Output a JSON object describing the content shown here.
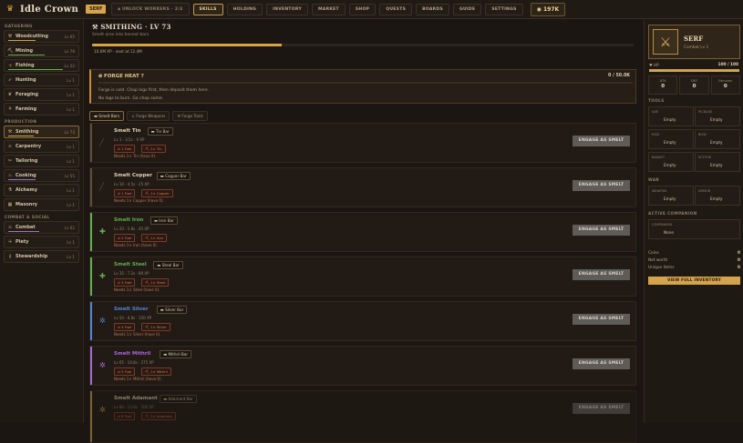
{
  "header": {
    "title": "Idle Crown",
    "rank_badge": "SERF",
    "unlock": "UNLOCK WORKERS · 2/4",
    "nav": [
      "SKILLS",
      "HOLDING",
      "INVENTORY",
      "MARKET",
      "SHOP",
      "QUESTS",
      "BOARDS",
      "GUIDE",
      "SETTINGS"
    ],
    "coins": "197K"
  },
  "sidebar": {
    "gathering_title": "GATHERING",
    "gathering": [
      {
        "name": "Woodcutting",
        "level": "Lv 65"
      },
      {
        "name": "Mining",
        "level": "Lv 78"
      },
      {
        "name": "Fishing",
        "level": "Lv 22"
      },
      {
        "name": "Hunting",
        "level": "Lv 1"
      },
      {
        "name": "Foraging",
        "level": "Lv 1"
      },
      {
        "name": "Farming",
        "level": "Lv 1"
      }
    ],
    "production_title": "PRODUCTION",
    "production": [
      {
        "name": "Smithing",
        "level": "Lv 73"
      },
      {
        "name": "Carpentry",
        "level": "Lv 1"
      },
      {
        "name": "Tailoring",
        "level": "Lv 1"
      },
      {
        "name": "Cooking",
        "level": "Lv 55"
      },
      {
        "name": "Alchemy",
        "level": "Lv 1"
      },
      {
        "name": "Masonry",
        "level": "Lv 1"
      }
    ],
    "combat_title": "COMBAT & SOCIAL",
    "combat": [
      {
        "name": "Combat",
        "level": "Lv 62"
      },
      {
        "name": "Piety",
        "level": "Lv 1"
      },
      {
        "name": "Stewardship",
        "level": "Lv 1"
      }
    ]
  },
  "main": {
    "title": "SMITHING · LV 73",
    "subtitle": "Smelt ores into honest bars.",
    "xp_progress": 0.35,
    "xp_text": "10.6M XP · next at 12.4M",
    "forge": {
      "title": "FORGE HEAT",
      "count": "0 / 50.0K",
      "line1": "Forge is cold. Chop logs first, then deposit them here.",
      "line2": "No logs to burn. Go chop some."
    },
    "tabs": [
      "Smelt Bars",
      "Forge Weapons",
      "Forge Tools"
    ],
    "recipes": [
      {
        "name": "Smelt Tin",
        "chip": "Tin Bar",
        "meta": "Lv 1 · 3.5s · 9 XP",
        "cost1": "1 Fuel",
        "cost2": "1× Tin",
        "need": "Needs 1× Tin (have 0).",
        "color": "#5e4d3b"
      },
      {
        "name": "Smelt Copper",
        "chip": "Copper Bar",
        "meta": "Lv 10 · 4.5s · 25 XP",
        "cost1": "1 Fuel",
        "cost2": "1× Copper",
        "need": "Needs 1× Copper (have 0).",
        "color": "#5e4d3b"
      },
      {
        "name": "Smelt Iron",
        "chip": "Iron Bar",
        "meta": "Lv 20 · 5.8s · 45 XP",
        "cost1": "2 Fuel",
        "cost2": "1× Iron",
        "need": "Needs 1× Iron (have 0).",
        "color": "#5fb04e"
      },
      {
        "name": "Smelt Steel",
        "chip": "Steel Bar",
        "meta": "Lv 35 · 7.2s · 80 XP",
        "cost1": "3 Fuel",
        "cost2": "1× Steel",
        "need": "Needs 1× Steel (have 0).",
        "color": "#5fb04e"
      },
      {
        "name": "Smelt Silver",
        "chip": "Silver Bar",
        "meta": "Lv 50 · 8.8s · 150 XP",
        "cost1": "4 Fuel",
        "cost2": "1× Silver",
        "need": "Needs 1× Silver (have 0).",
        "color": "#4f86d6"
      },
      {
        "name": "Smelt Mithril",
        "chip": "Mithril Bar",
        "meta": "Lv 65 · 10.8s · 275 XP",
        "cost1": "5 Fuel",
        "cost2": "1× Mithril",
        "need": "Needs 1× Mithril (have 0).",
        "color": "#a66ad6"
      },
      {
        "name": "Smelt Adamant",
        "chip": "Adamant Bar",
        "meta": "Lv 80 · 13.0s · 500 XP",
        "cost1": "6 Fuel",
        "cost2": "1× Adamant",
        "need": "",
        "color": "#c9a24a"
      }
    ],
    "engage_label": "ENGAGE AS SMELT"
  },
  "right": {
    "name": "SERF",
    "sub": "Combat Lv 1",
    "hp_label": "HP",
    "hp_value": "100 / 100",
    "stats": [
      {
        "label": "ATK",
        "value": "0"
      },
      {
        "label": "DEF",
        "value": "0"
      },
      {
        "label": "Renown",
        "value": "0"
      }
    ],
    "tools_title": "TOOLS",
    "tools": [
      {
        "slot": "AXE",
        "value": "Empty"
      },
      {
        "slot": "PICKAXE",
        "value": "Empty"
      },
      {
        "slot": "ROD",
        "value": "Empty"
      },
      {
        "slot": "BOW",
        "value": "Empty"
      },
      {
        "slot": "BASKET",
        "value": "Empty"
      },
      {
        "slot": "SCYTHE",
        "value": "Empty"
      }
    ],
    "war_title": "WAR",
    "war": [
      {
        "slot": "WEAPON",
        "value": "Empty"
      },
      {
        "slot": "ARMOR",
        "value": "Empty"
      }
    ],
    "companion_title": "ACTIVE COMPANION",
    "companion": {
      "slot": "COMPANION",
      "value": "None"
    },
    "summary": [
      {
        "label": "Coins",
        "value": "0"
      },
      {
        "label": "Net worth",
        "value": "0"
      },
      {
        "label": "Unique items",
        "value": "0"
      }
    ],
    "inventory_button": "VIEW FULL INVENTORY"
  }
}
